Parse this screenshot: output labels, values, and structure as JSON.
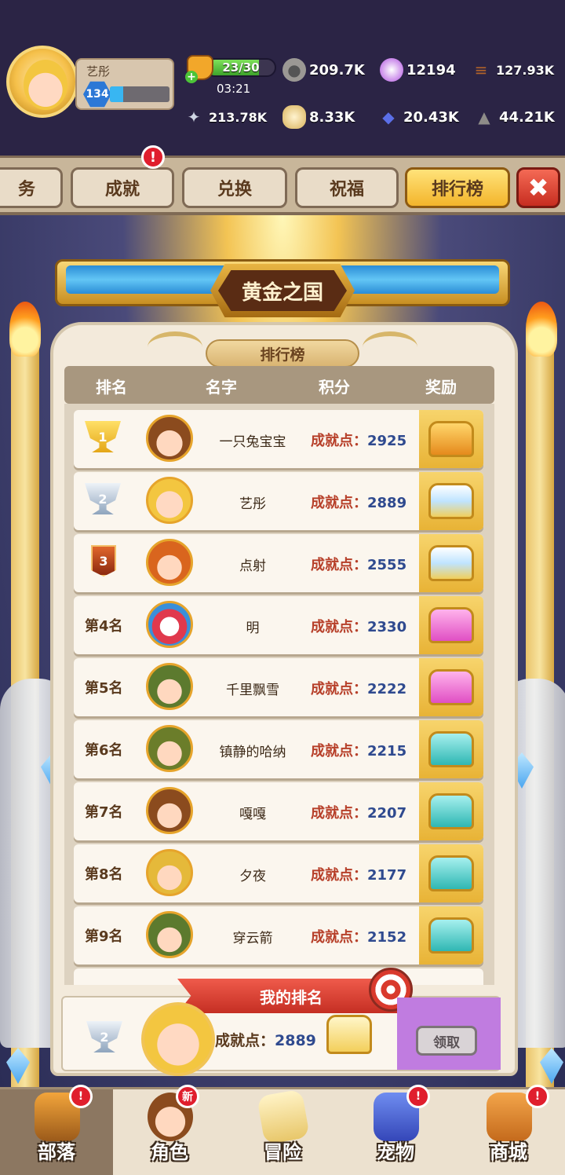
{
  "player": {
    "name": "艺彤",
    "level": "134",
    "xp_fraction": 0.22
  },
  "energy": {
    "value": "23/30",
    "fraction": 0.77,
    "timer": "03:21"
  },
  "resources": [
    {
      "icon": "stone-ore-icon",
      "value": "209.7K"
    },
    {
      "icon": "pearl-icon",
      "value": "12194"
    },
    {
      "icon": "wood-logs-icon",
      "value": "127.93K"
    },
    {
      "icon": "bone-icon",
      "value": "213.78K"
    },
    {
      "icon": "gold-stone-icon",
      "value": "8.33K"
    },
    {
      "icon": "blue-gem-icon",
      "value": "20.43K"
    },
    {
      "icon": "rock-icon",
      "value": "44.21K"
    }
  ],
  "tabs": [
    {
      "label": "务"
    },
    {
      "label": "成就"
    },
    {
      "label": "兑换"
    },
    {
      "label": "祝福"
    },
    {
      "label": "排行榜"
    }
  ],
  "close_icon": "✖",
  "banner_title": "黄金之国",
  "subtitle": "排行榜",
  "columns": {
    "rank": "排名",
    "name": "名字",
    "score": "积分",
    "reward": "奖励"
  },
  "score_label": "成就点：",
  "rows": [
    {
      "rank": "1",
      "name": "一只兔宝宝",
      "score": "2925",
      "chest": "legendary-chest-icon"
    },
    {
      "rank": "2",
      "name": "艺彤",
      "score": "2889",
      "chest": "diamond-chest-icon"
    },
    {
      "rank": "3",
      "name": "点射",
      "score": "2555",
      "chest": "diamond-chest-icon"
    },
    {
      "rank": "第4名",
      "name": "明",
      "score": "2330",
      "chest": "pink-chest-icon"
    },
    {
      "rank": "第5名",
      "name": "千里飘雪",
      "score": "2222",
      "chest": "pink-chest-icon"
    },
    {
      "rank": "第6名",
      "name": "镇静的哈纳",
      "score": "2215",
      "chest": "teal-chest-icon"
    },
    {
      "rank": "第7名",
      "name": "嘎嘎",
      "score": "2207",
      "chest": "teal-chest-icon"
    },
    {
      "rank": "第8名",
      "name": "夕夜",
      "score": "2177",
      "chest": "teal-chest-icon"
    },
    {
      "rank": "第9名",
      "name": "穿云箭",
      "score": "2152",
      "chest": "teal-chest-icon"
    }
  ],
  "my_rank": {
    "title": "我的排名",
    "rank": "2",
    "score": "2889",
    "claim_label": "领取"
  },
  "nav": [
    {
      "label": "部落",
      "badge": "!"
    },
    {
      "label": "角色",
      "badge": "新"
    },
    {
      "label": "冒险",
      "badge": ""
    },
    {
      "label": "宠物",
      "badge": "!"
    },
    {
      "label": "商城",
      "badge": "!"
    }
  ],
  "colors": {
    "accent_gold": "#f3b52b",
    "score_blue": "#2f4a8f",
    "score_red": "#b7402a",
    "alert_red": "#e01e2d"
  }
}
